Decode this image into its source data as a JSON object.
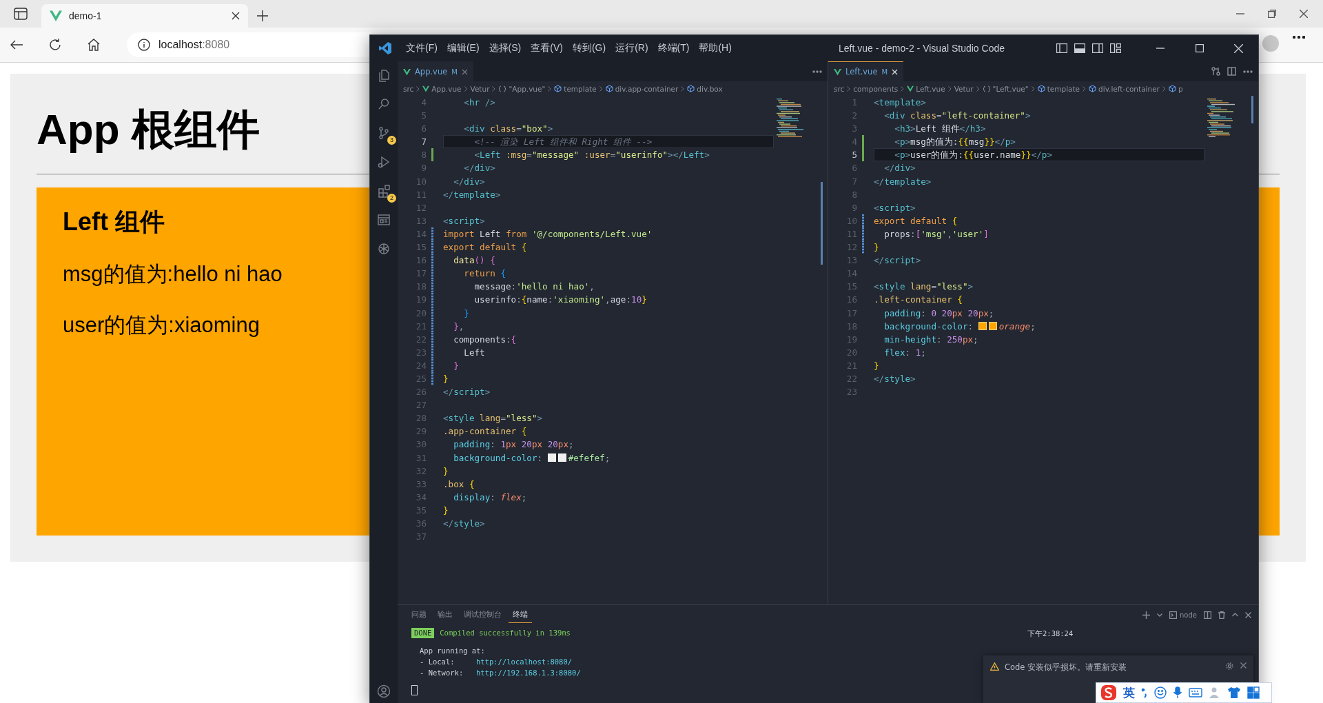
{
  "browser": {
    "tab": {
      "title": "demo-1"
    },
    "address": {
      "host": "localhost",
      "port": ":8080"
    }
  },
  "page": {
    "title": "App 根组件",
    "left": {
      "title": "Left 组件",
      "lines": [
        "msg的值为:hello ni hao",
        "user的值为:xiaoming"
      ]
    }
  },
  "vscode": {
    "menu": [
      "文件(F)",
      "编辑(E)",
      "选择(S)",
      "查看(V)",
      "转到(G)",
      "运行(R)",
      "终端(T)",
      "帮助(H)"
    ],
    "title": "Left.vue - demo-2 - Visual Studio Code",
    "activity": [
      {
        "kind": "files"
      },
      {
        "kind": "search"
      },
      {
        "kind": "branch",
        "badge": "3"
      },
      {
        "kind": "run"
      },
      {
        "kind": "extensions",
        "badge": "2"
      },
      {
        "kind": "panel"
      },
      {
        "kind": "knot"
      }
    ],
    "editors": [
      {
        "tab": {
          "label": "App.vue",
          "badge": "M",
          "selected": false
        },
        "breadcrumbs": [
          {
            "text": "src",
            "kind": "folder"
          },
          {
            "text": "App.vue",
            "kind": "file"
          },
          {
            "text": "Vetur",
            "kind": "folder"
          },
          {
            "text": "\"App.vue\"",
            "kind": "module"
          },
          {
            "text": "template",
            "kind": "element"
          },
          {
            "text": "div.app-container",
            "kind": "element"
          },
          {
            "text": "div.box",
            "kind": "element"
          }
        ],
        "lines": [
          {
            "number": "4",
            "tokens": [
              {
                "text": "    <",
                "kind": "punct"
              },
              {
                "text": "hr",
                "kind": "tag"
              },
              {
                "text": " />",
                "kind": "punct"
              }
            ]
          },
          {
            "number": "5"
          },
          {
            "number": "6",
            "tokens": [
              {
                "text": "    <",
                "kind": "punct"
              },
              {
                "text": "div",
                "kind": "tag"
              },
              {
                "text": " class",
                "kind": "attr"
              },
              {
                "text": "=",
                "kind": "op"
              },
              {
                "text": "\"box\"",
                "kind": "str"
              },
              {
                "text": ">",
                "kind": "punct"
              }
            ]
          },
          {
            "number": "7",
            "current": true,
            "tokens": [
              {
                "text": "      <!-- 渲染 Left 组件和 Right 组件 -->",
                "kind": "comment"
              }
            ]
          },
          {
            "number": "8",
            "added": true,
            "tokens": [
              {
                "text": "      <",
                "kind": "punct"
              },
              {
                "text": "Left",
                "kind": "tag"
              },
              {
                "text": " :msg",
                "kind": "attr"
              },
              {
                "text": "=",
                "kind": "op"
              },
              {
                "text": "\"message\"",
                "kind": "str"
              },
              {
                "text": " :user",
                "kind": "attr"
              },
              {
                "text": "=",
                "kind": "op"
              },
              {
                "text": "\"userinfo\"",
                "kind": "str"
              },
              {
                "text": "></",
                "kind": "punct"
              },
              {
                "text": "Left",
                "kind": "tag"
              },
              {
                "text": ">",
                "kind": "punct"
              }
            ]
          },
          {
            "number": "9",
            "tokens": [
              {
                "text": "    </",
                "kind": "punct"
              },
              {
                "text": "div",
                "kind": "tag"
              },
              {
                "text": ">",
                "kind": "punct"
              }
            ]
          },
          {
            "number": "10",
            "tokens": [
              {
                "text": "  </",
                "kind": "punct"
              },
              {
                "text": "div",
                "kind": "tag"
              },
              {
                "text": ">",
                "kind": "punct"
              }
            ]
          },
          {
            "number": "11",
            "tokens": [
              {
                "text": "</",
                "kind": "punct"
              },
              {
                "text": "template",
                "kind": "tag"
              },
              {
                "text": ">",
                "kind": "punct"
              }
            ]
          },
          {
            "number": "12"
          },
          {
            "number": "13",
            "tokens": [
              {
                "text": "<",
                "kind": "punct"
              },
              {
                "text": "script",
                "kind": "tag"
              },
              {
                "text": ">",
                "kind": "punct"
              }
            ]
          },
          {
            "number": "14",
            "modified": true,
            "tokens": [
              {
                "text": "import",
                "kind": "kw"
              },
              {
                "text": " Left ",
                "kind": "ident"
              },
              {
                "text": "from",
                "kind": "kw"
              },
              {
                "text": " '@/components/Left.vue'",
                "kind": "jsstr"
              }
            ]
          },
          {
            "number": "15",
            "modified": true,
            "tokens": [
              {
                "text": "export default",
                "kind": "kw"
              },
              {
                "text": " {",
                "kind": "b1"
              }
            ]
          },
          {
            "number": "16",
            "modified": true,
            "tokens": [
              {
                "text": "  data",
                "kind": "fn"
              },
              {
                "text": "() {",
                "kind": "b2"
              }
            ]
          },
          {
            "number": "17",
            "modified": true,
            "tokens": [
              {
                "text": "    return",
                "kind": "kw"
              },
              {
                "text": " {",
                "kind": "b3"
              }
            ]
          },
          {
            "number": "18",
            "modified": true,
            "tokens": [
              {
                "text": "      message",
                "kind": "ident"
              },
              {
                "text": ":",
                "kind": "op"
              },
              {
                "text": "'hello ni hao'",
                "kind": "jsstr"
              },
              {
                "text": ",",
                "kind": "op"
              }
            ]
          },
          {
            "number": "19",
            "modified": true,
            "tokens": [
              {
                "text": "      userinfo",
                "kind": "ident"
              },
              {
                "text": ":",
                "kind": "op"
              },
              {
                "text": "{",
                "kind": "b1"
              },
              {
                "text": "name",
                "kind": "ident"
              },
              {
                "text": ":",
                "kind": "op"
              },
              {
                "text": "'xiaoming'",
                "kind": "jsstr"
              },
              {
                "text": ",",
                "kind": "op"
              },
              {
                "text": "age",
                "kind": "ident"
              },
              {
                "text": ":",
                "kind": "op"
              },
              {
                "text": "10",
                "kind": "num"
              },
              {
                "text": "}",
                "kind": "b1"
              }
            ]
          },
          {
            "number": "20",
            "modified": true,
            "tokens": [
              {
                "text": "    }",
                "kind": "b3"
              }
            ]
          },
          {
            "number": "21",
            "modified": true,
            "tokens": [
              {
                "text": "  }",
                "kind": "b2"
              },
              {
                "text": ",",
                "kind": "op"
              }
            ]
          },
          {
            "number": "22",
            "modified": true,
            "tokens": [
              {
                "text": "  components",
                "kind": "ident"
              },
              {
                "text": ":",
                "kind": "op"
              },
              {
                "text": "{",
                "kind": "b2"
              }
            ]
          },
          {
            "number": "23",
            "modified": true,
            "tokens": [
              {
                "text": "    Left",
                "kind": "ident"
              }
            ]
          },
          {
            "number": "24",
            "modified": true,
            "tokens": [
              {
                "text": "  }",
                "kind": "b2"
              }
            ]
          },
          {
            "number": "25",
            "modified": true,
            "tokens": [
              {
                "text": "}",
                "kind": "b1"
              }
            ]
          },
          {
            "number": "26",
            "tokens": [
              {
                "text": "</",
                "kind": "punct"
              },
              {
                "text": "script",
                "kind": "tag"
              },
              {
                "text": ">",
                "kind": "punct"
              }
            ]
          },
          {
            "number": "27"
          },
          {
            "number": "28",
            "tokens": [
              {
                "text": "<",
                "kind": "punct"
              },
              {
                "text": "style",
                "kind": "tag"
              },
              {
                "text": " lang",
                "kind": "attr"
              },
              {
                "text": "=",
                "kind": "op"
              },
              {
                "text": "\"less\"",
                "kind": "str"
              },
              {
                "text": ">",
                "kind": "punct"
              }
            ]
          },
          {
            "number": "29",
            "tokens": [
              {
                "text": ".app-container",
                "kind": "sel"
              },
              {
                "text": " {",
                "kind": "b1"
              }
            ]
          },
          {
            "number": "30",
            "tokens": [
              {
                "text": "  padding",
                "kind": "prop"
              },
              {
                "text": ": ",
                "kind": "op"
              },
              {
                "text": "1",
                "kind": "num"
              },
              {
                "text": "px ",
                "kind": "unit"
              },
              {
                "text": "20",
                "kind": "num"
              },
              {
                "text": "px ",
                "kind": "unit"
              },
              {
                "text": "20",
                "kind": "num"
              },
              {
                "text": "px",
                "kind": "unit"
              },
              {
                "text": ";",
                "kind": "op"
              }
            ]
          },
          {
            "number": "31",
            "tokens": [
              {
                "text": "  background-color",
                "kind": "prop"
              },
              {
                "text": ": ",
                "kind": "op"
              },
              {
                "kind": "swatch",
                "color": "#efefef"
              },
              {
                "kind": "swatch",
                "color": "#efefef"
              },
              {
                "text": "#efefef",
                "kind": "hex"
              },
              {
                "text": ";",
                "kind": "op"
              }
            ]
          },
          {
            "number": "32",
            "tokens": [
              {
                "text": "}",
                "kind": "b1"
              }
            ]
          },
          {
            "number": "33",
            "tokens": [
              {
                "text": ".box",
                "kind": "sel"
              },
              {
                "text": " {",
                "kind": "b1"
              }
            ]
          },
          {
            "number": "34",
            "tokens": [
              {
                "text": "  display",
                "kind": "prop"
              },
              {
                "text": ": ",
                "kind": "op"
              },
              {
                "text": "flex",
                "kind": "val"
              },
              {
                "text": ";",
                "kind": "op"
              }
            ]
          },
          {
            "number": "35",
            "tokens": [
              {
                "text": "}",
                "kind": "b1"
              }
            ]
          },
          {
            "number": "36",
            "tokens": [
              {
                "text": "</",
                "kind": "punct"
              },
              {
                "text": "style",
                "kind": "tag"
              },
              {
                "text": ">",
                "kind": "punct"
              }
            ]
          },
          {
            "number": "37"
          }
        ]
      },
      {
        "tab": {
          "label": "Left.vue",
          "badge": "M",
          "selected": true
        },
        "breadcrumbs": [
          {
            "text": "src",
            "kind": "folder"
          },
          {
            "text": "components",
            "kind": "folder"
          },
          {
            "text": "Left.vue",
            "kind": "file"
          },
          {
            "text": "Vetur",
            "kind": "folder"
          },
          {
            "text": "\"Left.vue\"",
            "kind": "module"
          },
          {
            "text": "template",
            "kind": "element"
          },
          {
            "text": "div.left-container",
            "kind": "element"
          },
          {
            "text": "p",
            "kind": "element"
          }
        ],
        "lines": [
          {
            "number": "1",
            "tokens": [
              {
                "text": "<",
                "kind": "punct"
              },
              {
                "text": "template",
                "kind": "tag"
              },
              {
                "text": ">",
                "kind": "punct"
              }
            ]
          },
          {
            "number": "2",
            "tokens": [
              {
                "text": "  <",
                "kind": "punct"
              },
              {
                "text": "div",
                "kind": "tag"
              },
              {
                "text": " class",
                "kind": "attr"
              },
              {
                "text": "=",
                "kind": "op"
              },
              {
                "text": "\"left-container\"",
                "kind": "str"
              },
              {
                "text": ">",
                "kind": "punct"
              }
            ]
          },
          {
            "number": "3",
            "tokens": [
              {
                "text": "    <",
                "kind": "punct"
              },
              {
                "text": "h3",
                "kind": "tag"
              },
              {
                "text": ">",
                "kind": "punct"
              },
              {
                "text": "Left 组件",
                "kind": "ident"
              },
              {
                "text": "</",
                "kind": "punct"
              },
              {
                "text": "h3",
                "kind": "tag"
              },
              {
                "text": ">",
                "kind": "punct"
              }
            ]
          },
          {
            "number": "4",
            "added": true,
            "tokens": [
              {
                "text": "    <",
                "kind": "punct"
              },
              {
                "text": "p",
                "kind": "tag"
              },
              {
                "text": ">",
                "kind": "punct"
              },
              {
                "text": "msg的值为:",
                "kind": "ident"
              },
              {
                "text": "{{",
                "kind": "b1"
              },
              {
                "text": "msg",
                "kind": "ident"
              },
              {
                "text": "}}",
                "kind": "b1"
              },
              {
                "text": "</",
                "kind": "punct"
              },
              {
                "text": "p",
                "kind": "tag"
              },
              {
                "text": ">",
                "kind": "punct"
              }
            ]
          },
          {
            "number": "5",
            "added": true,
            "current": true,
            "tokens": [
              {
                "text": "    <",
                "kind": "punct"
              },
              {
                "text": "p",
                "kind": "tag"
              },
              {
                "text": ">",
                "kind": "punct"
              },
              {
                "text": "user的值为:",
                "kind": "ident"
              },
              {
                "text": "{{",
                "kind": "b1"
              },
              {
                "text": "user.name",
                "kind": "ident"
              },
              {
                "text": "}}",
                "kind": "b1"
              },
              {
                "text": "</",
                "kind": "punct"
              },
              {
                "text": "p",
                "kind": "tag"
              },
              {
                "text": ">",
                "kind": "punct"
              }
            ]
          },
          {
            "number": "6",
            "tokens": [
              {
                "text": "  </",
                "kind": "punct"
              },
              {
                "text": "div",
                "kind": "tag"
              },
              {
                "text": ">",
                "kind": "punct"
              }
            ]
          },
          {
            "number": "7",
            "tokens": [
              {
                "text": "</",
                "kind": "punct"
              },
              {
                "text": "template",
                "kind": "tag"
              },
              {
                "text": ">",
                "kind": "punct"
              }
            ]
          },
          {
            "number": "8"
          },
          {
            "number": "9",
            "tokens": [
              {
                "text": "<",
                "kind": "punct"
              },
              {
                "text": "script",
                "kind": "tag"
              },
              {
                "text": ">",
                "kind": "punct"
              }
            ]
          },
          {
            "number": "10",
            "modified": true,
            "tokens": [
              {
                "text": "export default",
                "kind": "kw"
              },
              {
                "text": " {",
                "kind": "b1"
              }
            ]
          },
          {
            "number": "11",
            "modified": true,
            "tokens": [
              {
                "text": "  props",
                "kind": "ident"
              },
              {
                "text": ":",
                "kind": "op"
              },
              {
                "text": "[",
                "kind": "b2"
              },
              {
                "text": "'msg'",
                "kind": "jsstr"
              },
              {
                "text": ",",
                "kind": "op"
              },
              {
                "text": "'user'",
                "kind": "jsstr"
              },
              {
                "text": "]",
                "kind": "b2"
              }
            ]
          },
          {
            "number": "12",
            "modified": true,
            "tokens": [
              {
                "text": "}",
                "kind": "b1"
              }
            ]
          },
          {
            "number": "13",
            "tokens": [
              {
                "text": "</",
                "kind": "punct"
              },
              {
                "text": "script",
                "kind": "tag"
              },
              {
                "text": ">",
                "kind": "punct"
              }
            ]
          },
          {
            "number": "14"
          },
          {
            "number": "15",
            "tokens": [
              {
                "text": "<",
                "kind": "punct"
              },
              {
                "text": "style",
                "kind": "tag"
              },
              {
                "text": " lang",
                "kind": "attr"
              },
              {
                "text": "=",
                "kind": "op"
              },
              {
                "text": "\"less\"",
                "kind": "str"
              },
              {
                "text": ">",
                "kind": "punct"
              }
            ]
          },
          {
            "number": "16",
            "tokens": [
              {
                "text": ".left-container",
                "kind": "sel"
              },
              {
                "text": " {",
                "kind": "b1"
              }
            ]
          },
          {
            "number": "17",
            "tokens": [
              {
                "text": "  padding",
                "kind": "prop"
              },
              {
                "text": ": ",
                "kind": "op"
              },
              {
                "text": "0 ",
                "kind": "num"
              },
              {
                "text": "20",
                "kind": "num"
              },
              {
                "text": "px ",
                "kind": "unit"
              },
              {
                "text": "20",
                "kind": "num"
              },
              {
                "text": "px",
                "kind": "unit"
              },
              {
                "text": ";",
                "kind": "op"
              }
            ]
          },
          {
            "number": "18",
            "tokens": [
              {
                "text": "  background-color",
                "kind": "prop"
              },
              {
                "text": ": ",
                "kind": "op"
              },
              {
                "kind": "swatch",
                "color": "#ffa500"
              },
              {
                "kind": "swatch",
                "color": "#ffa500"
              },
              {
                "text": "orange",
                "kind": "val"
              },
              {
                "text": ";",
                "kind": "op"
              }
            ]
          },
          {
            "number": "19",
            "tokens": [
              {
                "text": "  min-height",
                "kind": "prop"
              },
              {
                "text": ": ",
                "kind": "op"
              },
              {
                "text": "250",
                "kind": "num"
              },
              {
                "text": "px",
                "kind": "unit"
              },
              {
                "text": ";",
                "kind": "op"
              }
            ]
          },
          {
            "number": "20",
            "tokens": [
              {
                "text": "  flex",
                "kind": "prop"
              },
              {
                "text": ": ",
                "kind": "op"
              },
              {
                "text": "1",
                "kind": "num"
              },
              {
                "text": ";",
                "kind": "op"
              }
            ]
          },
          {
            "number": "21",
            "tokens": [
              {
                "text": "}",
                "kind": "b1"
              }
            ]
          },
          {
            "number": "22",
            "tokens": [
              {
                "text": "</",
                "kind": "punct"
              },
              {
                "text": "style",
                "kind": "tag"
              },
              {
                "text": ">",
                "kind": "punct"
              }
            ]
          },
          {
            "number": "23"
          }
        ]
      }
    ],
    "panel": {
      "tabs": [
        {
          "label": "问题",
          "selected": false
        },
        {
          "label": "输出",
          "selected": false
        },
        {
          "label": "调试控制台",
          "selected": false
        },
        {
          "label": "终端",
          "selected": true
        }
      ],
      "shell": "node",
      "terminal": {
        "badge": "DONE",
        "message": "Compiled successfully in 139ms",
        "time": "下午2:38:24",
        "heading": "App running at:",
        "links": [
          {
            "label": "- Local:",
            "url": "http://localhost:8080/"
          },
          {
            "label": "- Network:",
            "url": "http://192.168.1.3:8080/"
          }
        ]
      }
    },
    "notification": {
      "text": "Code 安装似乎损坏。请重新安装"
    }
  },
  "ime": {
    "mode": "英"
  }
}
